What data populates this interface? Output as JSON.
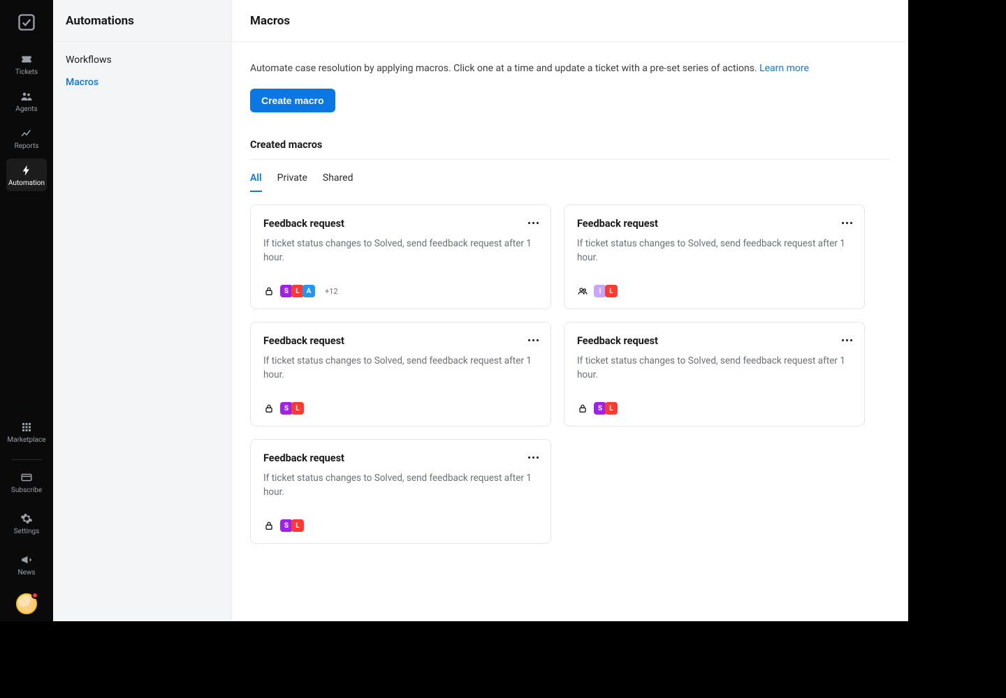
{
  "rail": {
    "items": [
      {
        "label": "Tickets"
      },
      {
        "label": "Agents"
      },
      {
        "label": "Reports"
      },
      {
        "label": "Automation"
      }
    ],
    "bottom": [
      {
        "label": "Marketplace"
      },
      {
        "label": "Subscribe"
      },
      {
        "label": "Settings"
      },
      {
        "label": "News"
      }
    ]
  },
  "sidebar": {
    "title": "Automations",
    "links": [
      {
        "label": "Workflows"
      },
      {
        "label": "Macros"
      }
    ],
    "active_index": 1
  },
  "page": {
    "title": "Macros",
    "intro_prefix": "Automate case resolution by applying macros. Click one at a time and update a ticket with a pre-set series of actions. ",
    "learn_more": "Learn more",
    "create_button": "Create macro",
    "list_heading": "Created macros"
  },
  "tabs": [
    {
      "label": "All",
      "active": true
    },
    {
      "label": "Private",
      "active": false
    },
    {
      "label": "Shared",
      "active": false
    }
  ],
  "macros": [
    {
      "title": "Feedback request",
      "desc": "If ticket status changes to Solved, send feedback request after 1 hour.",
      "visibility": "private",
      "chips": [
        {
          "letter": "S",
          "cls": "purple"
        },
        {
          "letter": "L",
          "cls": "red"
        },
        {
          "letter": "A",
          "cls": "blue"
        }
      ],
      "more": "+12"
    },
    {
      "title": "Feedback request",
      "desc": "If ticket status changes to Solved, send feedback request after 1 hour.",
      "visibility": "shared",
      "chips": [
        {
          "letter": "I",
          "cls": "lilac"
        },
        {
          "letter": "L",
          "cls": "red"
        }
      ],
      "more": null
    },
    {
      "title": "Feedback request",
      "desc": "If ticket status changes to Solved, send feedback request after 1 hour.",
      "visibility": "private",
      "chips": [
        {
          "letter": "S",
          "cls": "purple"
        },
        {
          "letter": "L",
          "cls": "red"
        }
      ],
      "more": null
    },
    {
      "title": "Feedback request",
      "desc": "If ticket status changes to Solved, send feedback request after 1 hour.",
      "visibility": "private",
      "chips": [
        {
          "letter": "S",
          "cls": "purple"
        },
        {
          "letter": "L",
          "cls": "red"
        }
      ],
      "more": null
    },
    {
      "title": "Feedback request",
      "desc": "If ticket status changes to Solved, send feedback request after 1 hour.",
      "visibility": "private",
      "chips": [
        {
          "letter": "S",
          "cls": "purple"
        },
        {
          "letter": "L",
          "cls": "red"
        }
      ],
      "more": null
    }
  ]
}
